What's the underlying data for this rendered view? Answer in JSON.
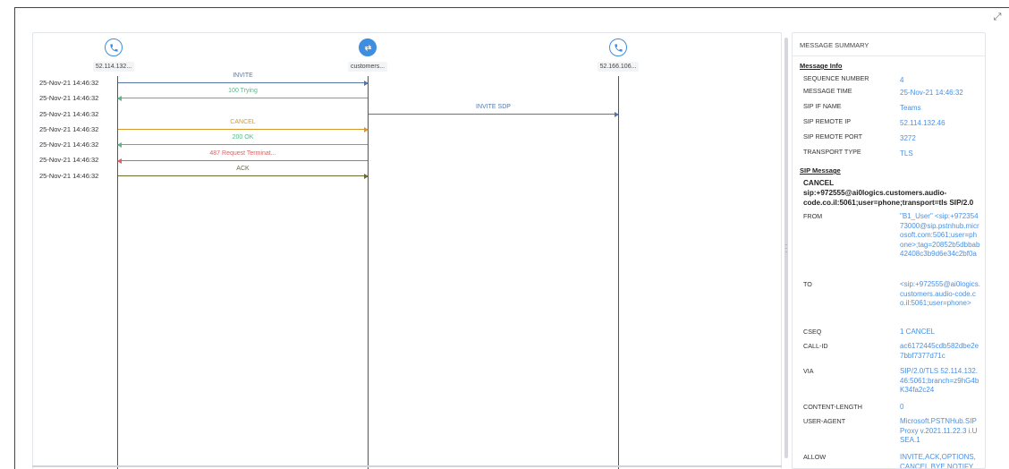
{
  "participants": [
    {
      "label": "52.114.132...",
      "icon": "phone-icon"
    },
    {
      "label": "customers...",
      "icon": "sbc-icon"
    },
    {
      "label": "52.166.106...",
      "icon": "phone-icon"
    }
  ],
  "messages": [
    {
      "time": "25-Nov-21 14:46:32",
      "label": "INVITE",
      "color": "#5577a8"
    },
    {
      "time": "25-Nov-21 14:46:32",
      "label": "100 Trying",
      "color": "#55b985"
    },
    {
      "time": "25-Nov-21 14:46:32",
      "label": "INVITE SDP",
      "color": "#5577a8"
    },
    {
      "time": "25-Nov-21 14:46:32",
      "label": "CANCEL",
      "color": "#d9982f"
    },
    {
      "time": "25-Nov-21 14:46:32",
      "label": "200 OK",
      "color": "#55b985"
    },
    {
      "time": "25-Nov-21 14:46:32",
      "label": "487 Request Terminat...",
      "color": "#e06060"
    },
    {
      "time": "25-Nov-21 14:46:32",
      "label": "ACK",
      "color": "#6b6b2f"
    }
  ],
  "summary": {
    "title": "MESSAGE SUMMARY",
    "message_info_title": "Message Info",
    "info": [
      {
        "label": "SEQUENCE NUMBER",
        "value": "4"
      },
      {
        "label": "MESSAGE TIME",
        "value": "25-Nov-21 14:46:32"
      },
      {
        "label": "SIP IF NAME",
        "value": "Teams"
      },
      {
        "label": "SIP REMOTE IP",
        "value": "52.114.132.46"
      },
      {
        "label": "SIP REMOTE PORT",
        "value": "3272"
      },
      {
        "label": "TRANSPORT TYPE",
        "value": "TLS"
      }
    ],
    "sip_message_title": "SIP Message",
    "request_line": "CANCEL sip:+972555@ai0logics.customers.audio-code.co.il:5061;user=phone;transport=tls SIP/2.0",
    "headers": [
      {
        "label": "FROM",
        "value": "\"B1_User\" <sip:+97235473000@sip.pstnhub.microsoft.com:5061;user=phone>;tag=20852b5dbbab42408c3b9d6e34c2bf0a"
      },
      {
        "label": "TO",
        "value": "<sip:+972555@ai0logics.customers.audio-code.co.il:5061;user=phone>"
      },
      {
        "label": "CSEQ",
        "value": "1 CANCEL"
      },
      {
        "label": "CALL-ID",
        "value": "ac6172445cdb582dbe2e7bbf7377d71c"
      },
      {
        "label": "VIA",
        "value": "SIP/2.0/TLS 52.114.132.46:5061;branch=z9hG4bK34fa2c24"
      },
      {
        "label": "CONTENT-LENGTH",
        "value": "0"
      },
      {
        "label": "USER-AGENT",
        "value": "Microsoft.PSTNHub.SIPProxy v.2021.11.22.3 i.USEA.1"
      },
      {
        "label": "ALLOW",
        "value": "INVITE,ACK,OPTIONS,CANCEL,BYE,NOTIFY"
      }
    ]
  }
}
